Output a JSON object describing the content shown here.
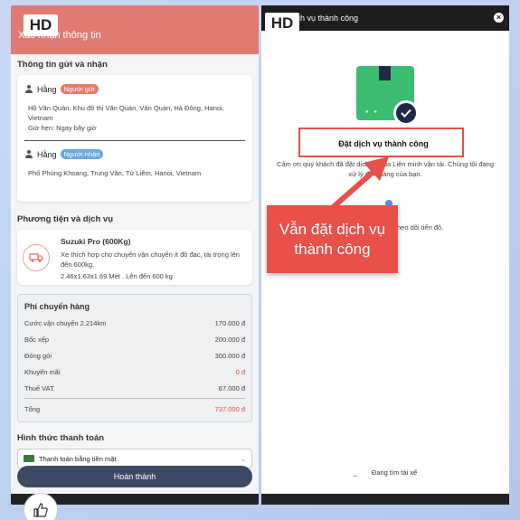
{
  "left": {
    "hd_badge": "HD",
    "header_title": "Xác nhận thông tin",
    "send_receive_title": "Thông tin gửi và nhận",
    "sender": {
      "name": "Hằng",
      "tag": "Người gửi",
      "address": "Hồ Văn Quán, Khu đô thị Văn Quán, Văn Quán, Hà Đông, Hanoi, Vietnam",
      "time": "Giờ hẹn: Ngay bây giờ"
    },
    "receiver": {
      "name": "Hằng",
      "tag": "Người nhận",
      "address": "Phố Phùng Khoang, Trung Văn, Từ Liêm, Hanoi, Vietnam"
    },
    "service_title": "Phương tiện và dịch vụ",
    "service": {
      "name": "Suzuki Pro (600Kg)",
      "desc": "Xe thích hợp cho chuyển vận chuyển ít đồ đạc, tải trọng lên đến 600kg.",
      "dims": "2.46x1.63x1.69 Mét . Lên đến 600 kg"
    },
    "fees": {
      "title": "Phí chuyển hàng",
      "rows": [
        {
          "label": "Cước vận chuyển 2.214km",
          "value": "170.000 đ"
        },
        {
          "label": "Bốc xếp",
          "value": "200.000 đ"
        },
        {
          "label": "Đóng gói",
          "value": "300.000 đ"
        },
        {
          "label": "Khuyến mãi",
          "value": "0 đ"
        },
        {
          "label": "Thuế VAT",
          "value": "67.000 đ"
        }
      ],
      "total_label": "Tổng",
      "total_value": "737.000 đ"
    },
    "payment_title": "Hình thức thanh toán",
    "payment_method": "Thanh toán bằng tiền mặt",
    "complete_button": "Hoàn thành"
  },
  "right": {
    "hd_badge": "HD",
    "header_title": "Dịch vụ thành công",
    "success_title": "Đặt dịch vụ thành công",
    "success_msg": "Cảm ơn quý khách đã đặt dịch vụ của Liên minh vận tải. Chúng tôi đang xử lý đơn hàng của bạn.",
    "follow_msg": "heo dõi tiến độ.",
    "searching": "Đang tìm tài xế"
  },
  "annotation": {
    "callout_text": "Vẫn đặt dịch vụ thành công"
  },
  "colors": {
    "header_red": "#e07a73",
    "accent_navy": "#3d4a66",
    "success_green": "#3dbd72",
    "annotation_red": "#e8504a"
  }
}
